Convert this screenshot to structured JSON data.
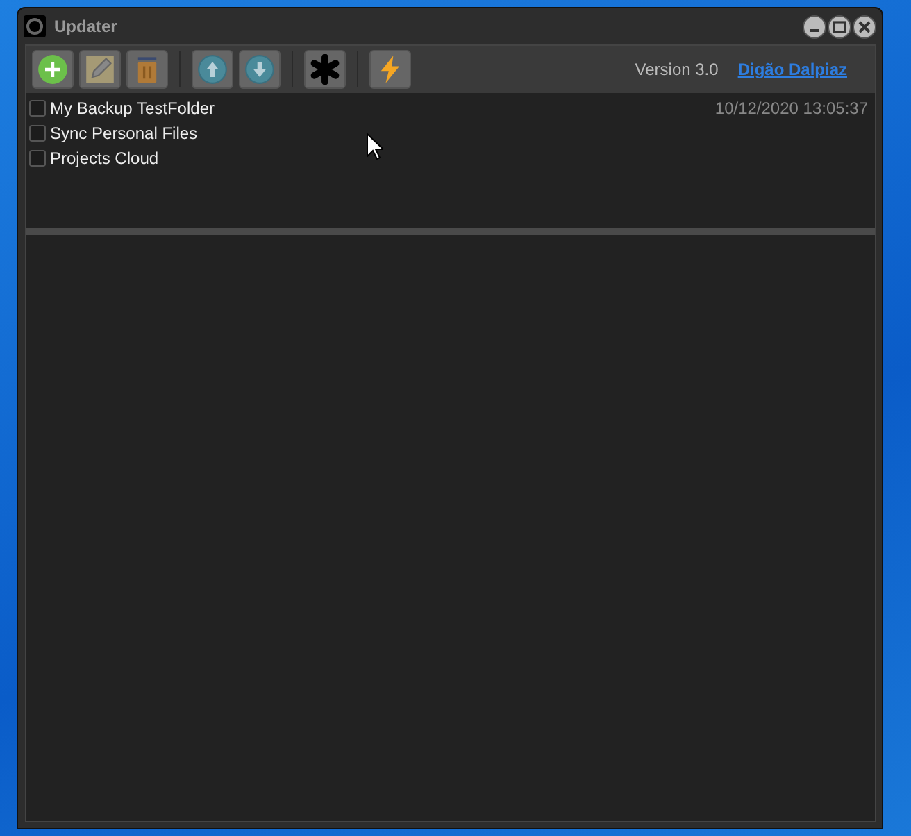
{
  "window": {
    "title": "Updater"
  },
  "toolbar": {
    "groups": [
      [
        {
          "kind": "add"
        },
        {
          "kind": "edit"
        },
        {
          "kind": "delete"
        }
      ],
      [
        {
          "kind": "up"
        },
        {
          "kind": "down"
        }
      ],
      [
        {
          "kind": "settings"
        }
      ],
      [
        {
          "kind": "run"
        }
      ]
    ],
    "version": "Version 3.0",
    "author_link": "Digão Dalpiaz"
  },
  "items": [
    {
      "name": "My Backup TestFolder",
      "checked": false,
      "timestamp": "10/12/2020 13:05:37"
    },
    {
      "name": "Sync Personal Files",
      "checked": false
    },
    {
      "name": "Projects Cloud",
      "checked": false
    }
  ]
}
